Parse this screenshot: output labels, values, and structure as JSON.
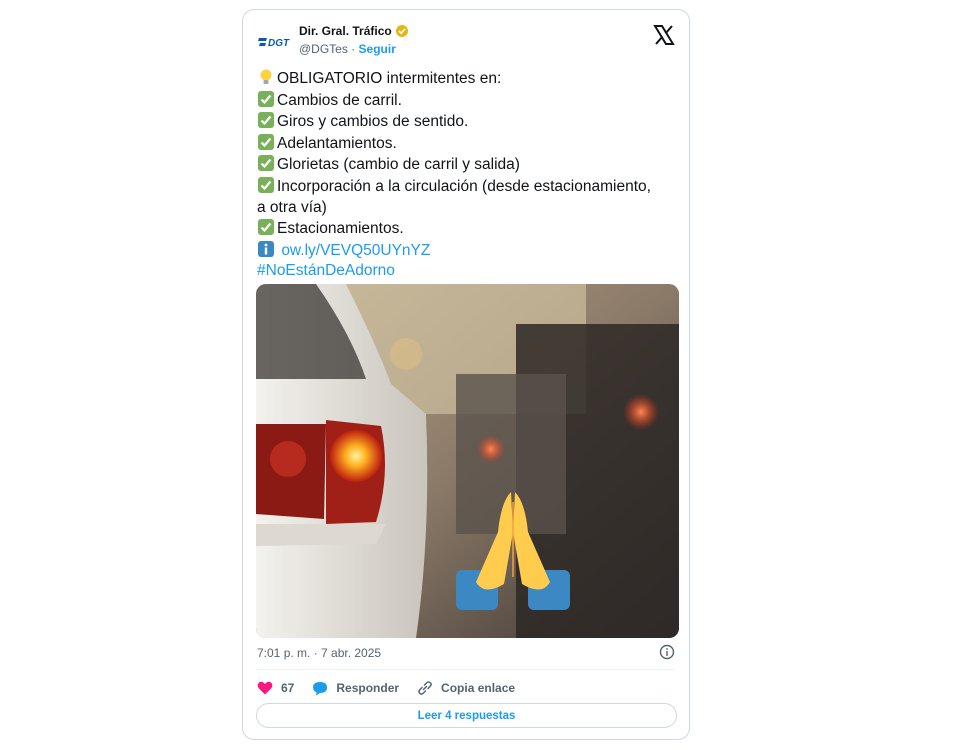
{
  "author": {
    "name": "Dir. Gral. Tráfico",
    "handle": "@DGTes",
    "separator": "·",
    "follow_label": "Seguir",
    "logo_text": "DGT"
  },
  "tweet": {
    "lines": [
      {
        "emoji": "bulb-icon",
        "text": "OBLIGATORIO intermitentes en:"
      },
      {
        "emoji": "check-icon",
        "text": "Cambios de carril."
      },
      {
        "emoji": "check-icon",
        "text": "Giros y cambios de sentido."
      },
      {
        "emoji": "check-icon",
        "text": "Adelantamientos."
      },
      {
        "emoji": "check-icon",
        "text": "Glorietas (cambio de carril y salida)"
      },
      {
        "emoji": "check-icon",
        "text": "Incorporación a la circulación (desde estacionamiento,"
      },
      {
        "emoji": "",
        "text": "a otra vía)"
      },
      {
        "emoji": "check-icon",
        "text": "Estacionamientos."
      }
    ],
    "link_icon": "info-icon",
    "link": "ow.ly/VEVQ50UYnYZ",
    "hashtag": "#NoEstánDeAdorno"
  },
  "media": {
    "description_icon": "praying-hands-icon"
  },
  "meta": {
    "timestamp": "7:01 p. m. · 7 abr. 2025"
  },
  "actions": {
    "likes": "67",
    "reply_label": "Responder",
    "copy_label": "Copia enlace",
    "read_replies": "Leer 4 respuestas"
  },
  "colors": {
    "accent": "#1d9bf0",
    "heart": "#f91880",
    "text": "#0f1419",
    "muted": "#536471",
    "check_green": "#78b159",
    "dgt_blue": "#0c5aa6"
  }
}
